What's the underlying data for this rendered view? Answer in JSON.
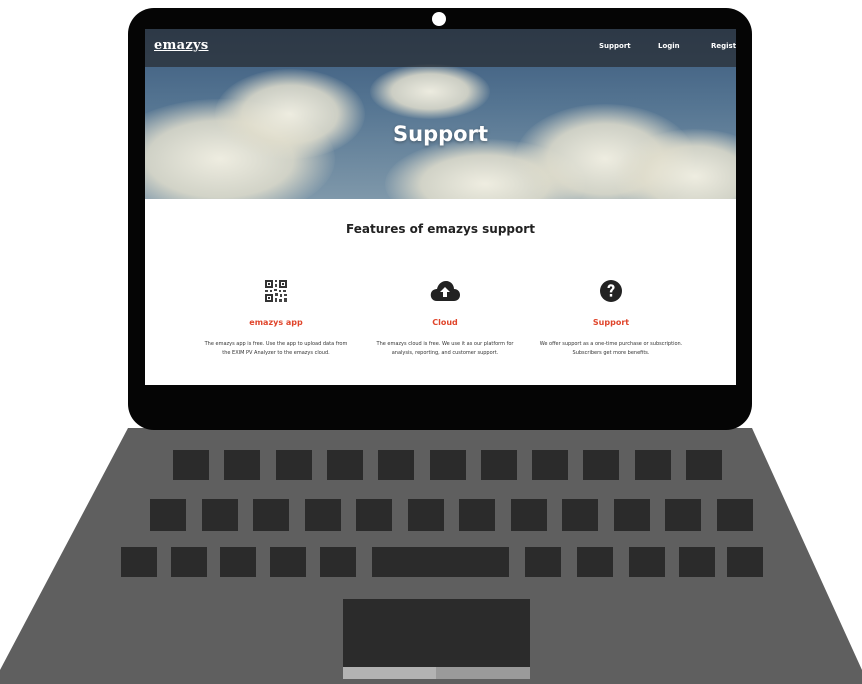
{
  "site": {
    "logo": "emazys"
  },
  "nav": {
    "items": [
      "Support",
      "Login",
      "Registr"
    ]
  },
  "hero": {
    "title": "Support"
  },
  "features": {
    "title": "Features of emazys support",
    "items": [
      {
        "icon": "qr-code-icon",
        "name": "emazys app",
        "desc": "The emazys app is free. Use the app to upload data from the EXIM PV Analyzer to the emazys cloud."
      },
      {
        "icon": "cloud-upload-icon",
        "name": "Cloud",
        "desc": "The emazys cloud is free. We use it as our platform for analysis, reporting, and customer support."
      },
      {
        "icon": "question-circle-icon",
        "name": "Support",
        "desc": "We offer support as a one-time purchase or subscription. Subscribers get more benefits."
      }
    ]
  },
  "colors": {
    "accent": "#e0452b",
    "laptop_body": "#5f5f5f",
    "keys": "#2b2b2b",
    "bezel": "#050505"
  }
}
